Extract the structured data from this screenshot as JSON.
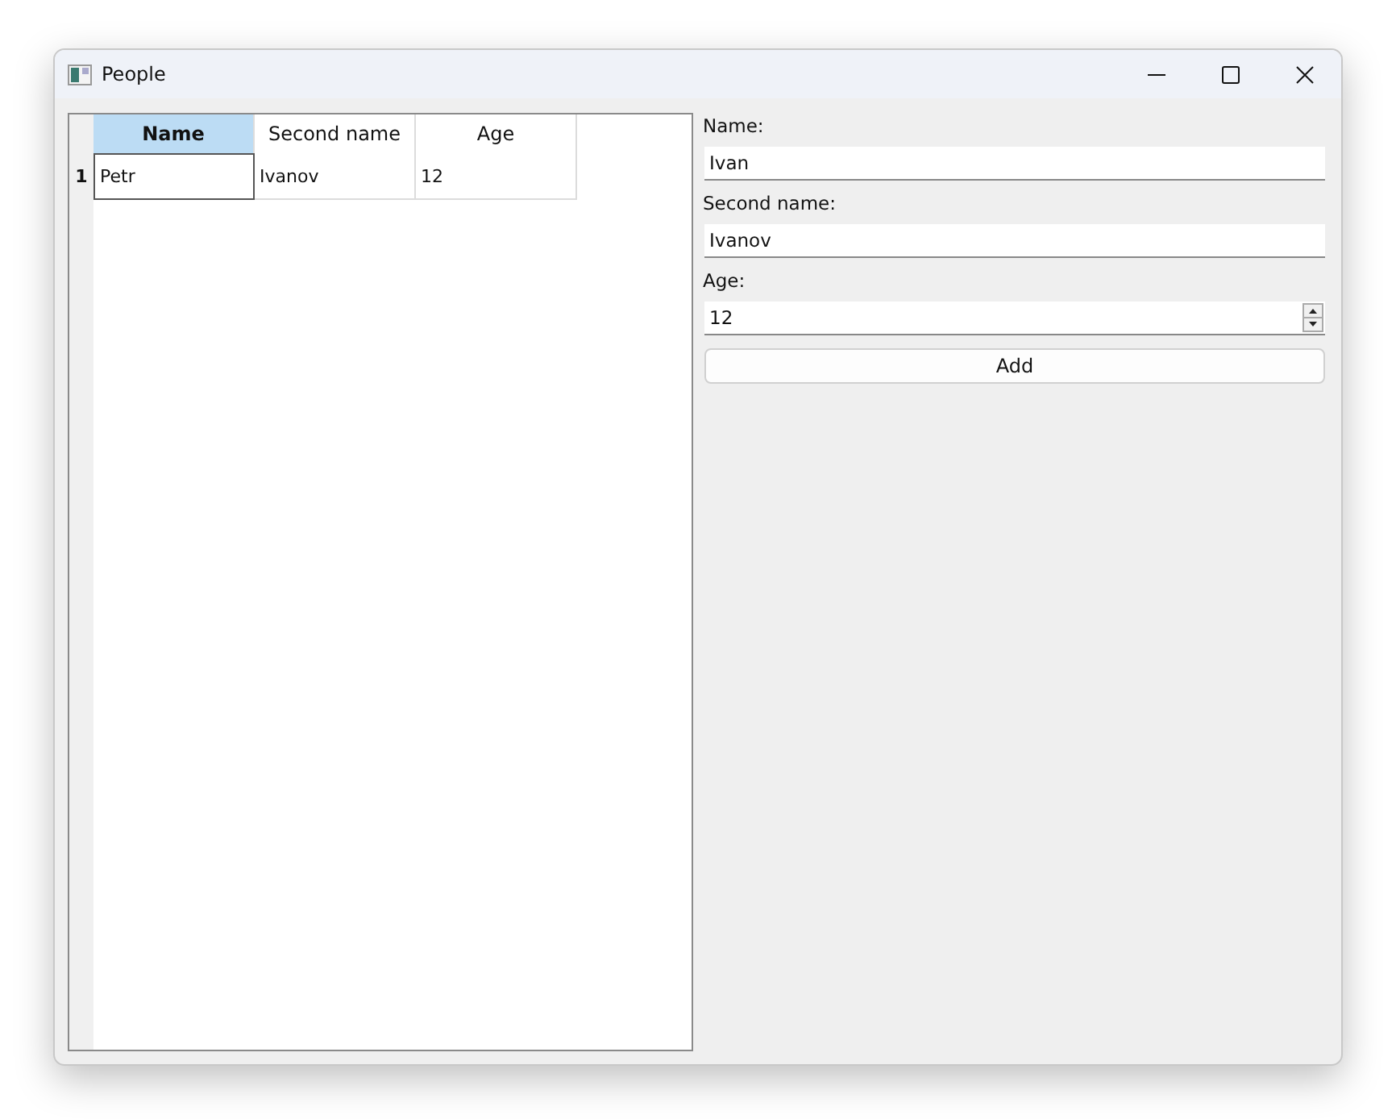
{
  "window": {
    "title": "People"
  },
  "table": {
    "columns": [
      {
        "label": "Name",
        "selected": true
      },
      {
        "label": "Second name",
        "selected": false
      },
      {
        "label": "Age",
        "selected": false
      }
    ],
    "rows": [
      {
        "header": "1",
        "selected": true,
        "cells": [
          {
            "text": "Petr",
            "current": true
          },
          {
            "text": "Ivanov",
            "current": false
          },
          {
            "text": "12",
            "current": false
          }
        ]
      }
    ]
  },
  "form": {
    "fields": [
      {
        "kind": "text",
        "label": "Name:",
        "value": "Ivan"
      },
      {
        "kind": "text",
        "label": "Second name:",
        "value": "Ivanov"
      },
      {
        "kind": "spin",
        "label": "Age:",
        "value": "12"
      }
    ],
    "button": "Add"
  }
}
